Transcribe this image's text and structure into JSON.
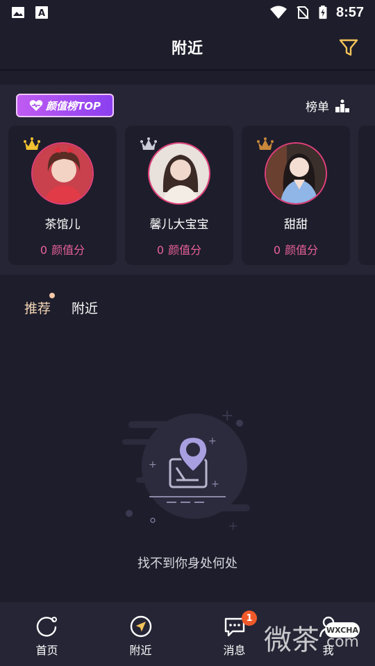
{
  "status_bar": {
    "time": "8:57",
    "icons": [
      "image-icon",
      "font-icon",
      "wifi-icon",
      "no-sim-icon",
      "battery-charging-icon"
    ]
  },
  "header": {
    "title": "附近",
    "filter_icon": "filter-icon"
  },
  "ranking": {
    "badge_label": "颜值榜TOP",
    "list_link_label": "榜单",
    "cards": [
      {
        "name": "茶馆儿",
        "score": "0",
        "score_label": "颜值分",
        "crown_color": "#f2c230"
      },
      {
        "name": "馨儿大宝宝",
        "score": "0",
        "score_label": "颜值分",
        "crown_color": "#c9cbd6"
      },
      {
        "name": "甜甜",
        "score": "0",
        "score_label": "颜值分",
        "crown_color": "#c9873a"
      }
    ]
  },
  "tabs": [
    {
      "label": "推荐",
      "active": true
    },
    {
      "label": "附近",
      "active": false
    }
  ],
  "empty_state": {
    "message": "找不到你身处何处"
  },
  "bottom_nav": [
    {
      "label": "首页",
      "icon": "home-icon"
    },
    {
      "label": "附近",
      "icon": "nearby-icon"
    },
    {
      "label": "消息",
      "icon": "message-icon",
      "badge": "1"
    },
    {
      "label": "我",
      "icon": "profile-icon"
    }
  ],
  "watermark": {
    "text": "微茶",
    "box": "WXCHA",
    "suffix": "com"
  },
  "colors": {
    "background": "#1e1d2b",
    "panel": "#262535",
    "accent_pink": "#e9619a",
    "active_tab": "#f3d6b6",
    "badge_orange": "#f05a2a"
  }
}
